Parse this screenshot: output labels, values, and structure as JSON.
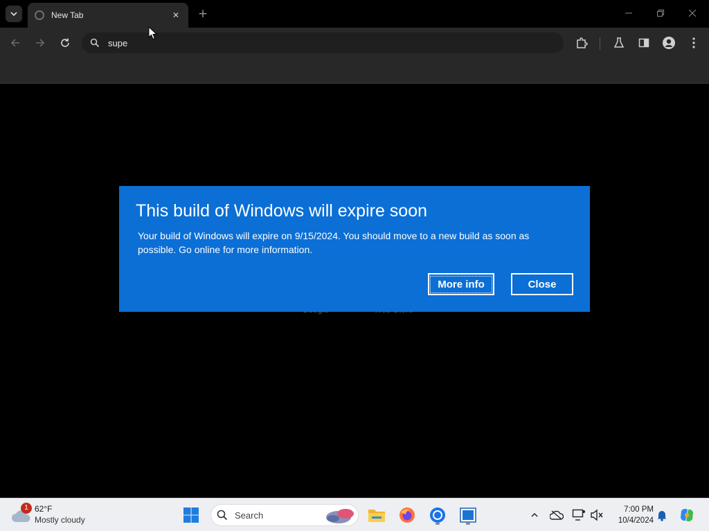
{
  "browser": {
    "tab_title": "New Tab",
    "omnibox_text": "supe",
    "new_tab_symbol": "+",
    "tab_close_symbol": "✕"
  },
  "page": {
    "shortcut_labels": [
      "Google",
      "Web Store"
    ]
  },
  "dialog": {
    "title": "This build of Windows will expire soon",
    "message": "Your build of Windows will expire on 9/15/2024. You should move to a new build as soon as possible. Go online for more information.",
    "more_info_label": "More info",
    "close_label": "Close",
    "background_color": "#0b6fd6"
  },
  "taskbar": {
    "weather": {
      "temperature": "62°F",
      "condition": "Mostly cloudy",
      "notification_count": "1"
    },
    "search_label": "Search",
    "clock": {
      "time": "7:00 PM",
      "date": "10/4/2024"
    },
    "pinned_apps": [
      "start-icon",
      "file-explorer-icon",
      "firefox-icon",
      "chrome-icon",
      "app-icon"
    ],
    "tray_icons": [
      "chevron-up-icon",
      "onedrive-icon",
      "network-icon",
      "volume-icon",
      "notification-bell-icon",
      "copilot-icon"
    ]
  }
}
